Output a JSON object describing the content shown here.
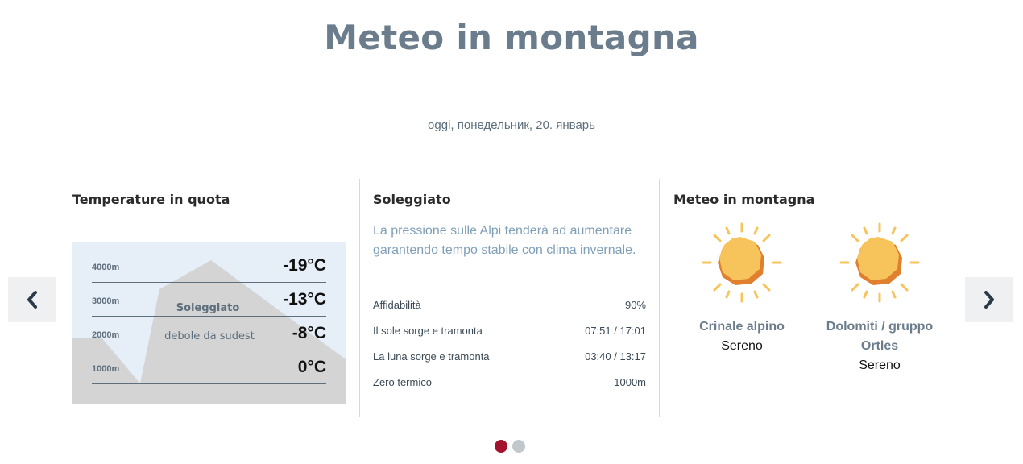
{
  "page": {
    "title": "Meteo in montagna",
    "date": "oggi, понедельник, 20. январь"
  },
  "navigation": {
    "prev_icon": "chevron-left-icon",
    "next_icon": "chevron-right-icon"
  },
  "altitude_card": {
    "title": "Temperature in quota",
    "condition": "Soleggiato",
    "wind": "debole da sudest",
    "levels": [
      {
        "altitude": "4000m",
        "temp": "-19°C"
      },
      {
        "altitude": "3000m",
        "temp": "-13°C"
      },
      {
        "altitude": "2000m",
        "temp": "-8°C"
      },
      {
        "altitude": "1000m",
        "temp": "0°C"
      }
    ]
  },
  "forecast_card": {
    "title": "Soleggiato",
    "summary": "La pressione sulle Alpi tenderà ad aumentare garantendo tempo stabile con clima invernale.",
    "rows": [
      {
        "label": "Affidabilità",
        "value": "90%"
      },
      {
        "label": "Il sole sorge e tramonta",
        "value": "07:51 / 17:01"
      },
      {
        "label": "La luna sorge e tramonta",
        "value": "03:40 / 13:17"
      },
      {
        "label": "Zero termico",
        "value": "1000m"
      }
    ]
  },
  "regions_card": {
    "title": "Meteo in montagna",
    "regions": [
      {
        "name": "Crinale alpino",
        "condition": "Sereno",
        "icon": "sun-icon"
      },
      {
        "name": "Dolomiti / gruppo Ortles",
        "condition": "Sereno",
        "icon": "sun-icon"
      }
    ]
  },
  "pagination": {
    "pages": 2,
    "active": 1
  },
  "colors": {
    "title": "#6b7d8c",
    "summary_text": "#7f9fb8",
    "active_dot": "#a4132e",
    "inactive_dot": "#c2c7cc",
    "sky": "#e6eef7",
    "mountain": "#d4d4d4",
    "sun": "#f7c35b"
  }
}
